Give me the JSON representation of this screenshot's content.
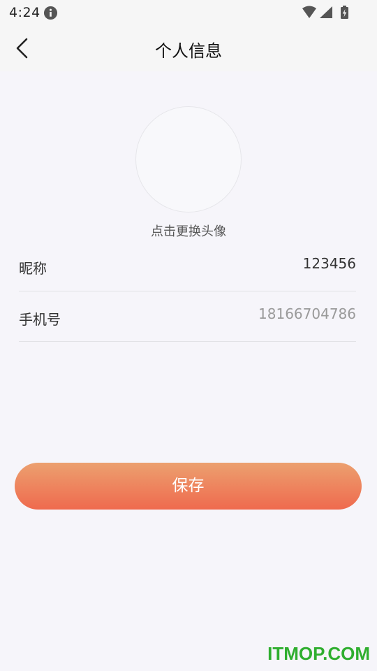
{
  "status_bar": {
    "time": "4:24",
    "icons": [
      "info-icon",
      "wifi-icon",
      "cell-signal-icon",
      "battery-icon"
    ]
  },
  "header": {
    "title": "个人信息",
    "back_icon": "chevron-left-icon"
  },
  "avatar": {
    "label": "点击更换头像"
  },
  "form": {
    "nickname": {
      "label": "昵称",
      "value": "123456"
    },
    "phone": {
      "label": "手机号",
      "value": "18166704786"
    }
  },
  "actions": {
    "save_label": "保存"
  },
  "watermark": "ITMOP.COM",
  "colors": {
    "background": "#f6f5fa",
    "save_gradient_top": "#eca06f",
    "save_gradient_bottom": "#ef6a4e",
    "watermark": "#2fae2f"
  }
}
